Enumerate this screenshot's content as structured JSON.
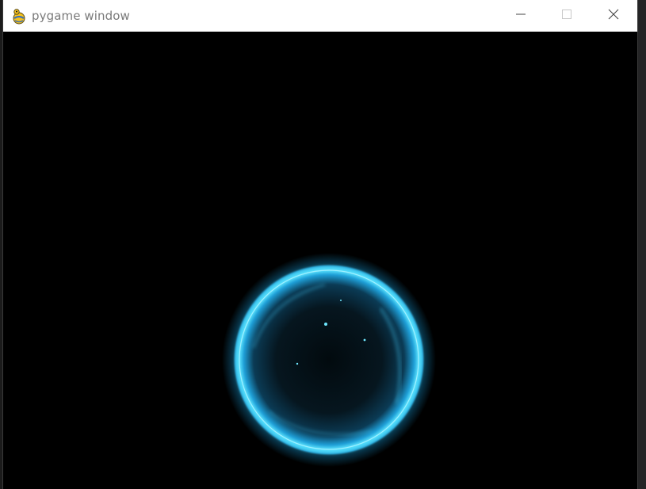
{
  "window": {
    "title": "pygame window"
  },
  "icons": {
    "app": "pygame-snake-icon",
    "minimize": "minimize-icon",
    "maximize": "maximize-icon",
    "close": "close-icon"
  },
  "colors": {
    "titlebar": "#ffffff",
    "title_text": "#7a7a7a",
    "canvas": "#000000",
    "orb_glow": "#2fd0ff",
    "orb_core": "#06141c"
  }
}
